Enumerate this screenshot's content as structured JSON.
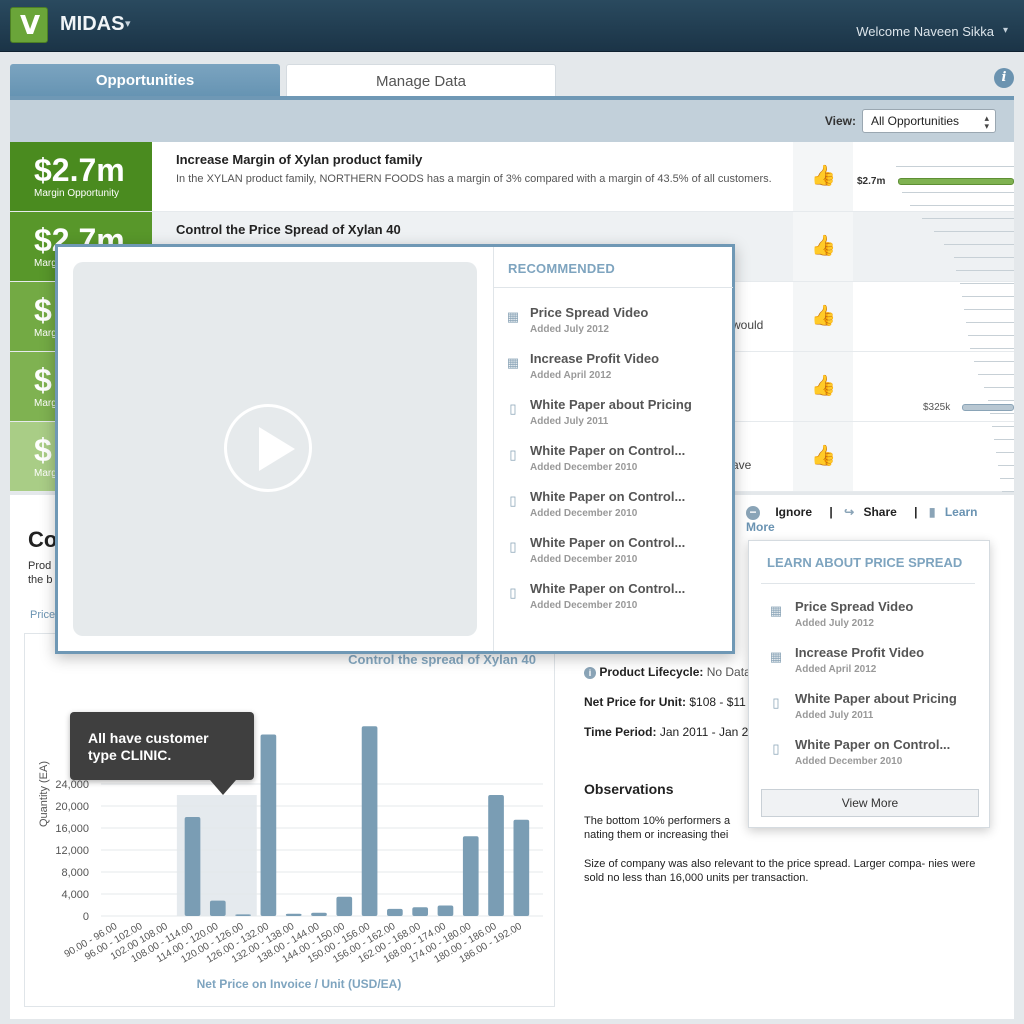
{
  "header": {
    "app_name": "MIDAS",
    "app_caret": "▾",
    "welcome": "Welcome Naveen Sikka",
    "welcome_caret": "▾",
    "logo_icon": "vf-logo",
    "logo_glyph": "V"
  },
  "tabs": [
    {
      "label": "Opportunities",
      "active": true
    },
    {
      "label": "Manage Data",
      "active": false
    }
  ],
  "info_icon": "i",
  "view": {
    "label": "View:",
    "selected": "All Opportunities",
    "caret": "▴▾"
  },
  "opportunities": [
    {
      "amount": "$2.7m",
      "amount_label": "Margin Opportunity",
      "title": "Increase Margin of Xylan product family",
      "description": "In the XYLAN product family, NORTHERN FOODS has a margin of 3% compared with a margin of 43.5% of all customers.",
      "fragment": "",
      "color": "#4a8b1f"
    },
    {
      "amount": "$2.7m",
      "amount_label": "Margin Opportunity",
      "title": "Control the Price Spread of Xylan 40",
      "description": "",
      "fragment": "",
      "color": "#58972a"
    },
    {
      "amount": "$",
      "amount_label": "Margin Opportunity",
      "title": "",
      "description": "",
      "fragment": "would",
      "color": "#73aa44"
    },
    {
      "amount": "$",
      "amount_label": "Margin Opportunity",
      "title": "",
      "description": "",
      "fragment": "",
      "color": "#7fb251"
    },
    {
      "amount": "$",
      "amount_label": "Margin Opportunity",
      "title": "",
      "description": "",
      "fragment": "ave",
      "color": "#a9cd86"
    }
  ],
  "spark": {
    "top_label": "$2.7m",
    "mid_label": "$325k",
    "top_color": "#7fb251",
    "mid_color": "#b8c7d2"
  },
  "lower": {
    "title": "Co",
    "subtitle_line1": "Prod",
    "subtitle_line2": "the b",
    "link": "Price"
  },
  "actions": {
    "ignore": "Ignore",
    "sep1": "|",
    "share": "Share",
    "sep2": "|",
    "learn_more": "Learn More",
    "ignore_glyph": "−",
    "share_glyph": "↪",
    "book_glyph": "▮",
    "ignore_icon": "minus-circle-icon",
    "share_icon": "share-arrow-icon",
    "learn_icon": "book-icon"
  },
  "details": {
    "lifecycle_key": "Product Lifecycle:",
    "lifecycle_val": "No Data",
    "net_price_key": "Net Price for Unit:",
    "net_price_val": "$108 - $11",
    "time_period_key": "Time Period:",
    "time_period_val": "Jan 2011 - Jan 2",
    "obs_title": "Observations",
    "obs_1": "The bottom 10% performers a",
    "obs_1b": "nating them or increasing thei",
    "obs_2": "Size of company was also relevant to the price spread. Larger compa- nies were sold no less than 16,000 units per transaction.",
    "info_glyph": "i"
  },
  "modal": {
    "recommended_title": "RECOMMENDED",
    "items": [
      {
        "name": "Price Spread Video",
        "date": "Added July 2012",
        "icon": "film-icon",
        "glyph": "▦"
      },
      {
        "name": "Increase Profit Video",
        "date": "Added April 2012",
        "icon": "film-icon",
        "glyph": "▦"
      },
      {
        "name": "White Paper about Pricing",
        "date": "Added July 2011",
        "icon": "document-icon",
        "glyph": "▯"
      },
      {
        "name": "White Paper on Control...",
        "date": "Added December 2010",
        "icon": "document-icon",
        "glyph": "▯"
      },
      {
        "name": "White Paper on Control...",
        "date": "Added December 2010",
        "icon": "document-icon",
        "glyph": "▯"
      },
      {
        "name": "White Paper on Control...",
        "date": "Added December 2010",
        "icon": "document-icon",
        "glyph": "▯"
      },
      {
        "name": "White Paper on Control...",
        "date": "Added December 2010",
        "icon": "document-icon",
        "glyph": "▯"
      }
    ]
  },
  "popover": {
    "title": "LEARN ABOUT PRICE SPREAD",
    "items": [
      {
        "name": "Price Spread Video",
        "date": "Added July 2012",
        "icon": "film-icon",
        "glyph": "▦"
      },
      {
        "name": "Increase Profit Video",
        "date": "Added April 2012",
        "icon": "film-icon",
        "glyph": "▦"
      },
      {
        "name": "White Paper about Pricing",
        "date": "Added July 2011",
        "icon": "document-icon",
        "glyph": "▯"
      },
      {
        "name": "White Paper on Control...",
        "date": "Added December 2010",
        "icon": "document-icon",
        "glyph": "▯"
      }
    ],
    "view_more": "View More"
  },
  "tooltip": {
    "text": "All have customer type CLINIC."
  },
  "thumb_glyph": "👍",
  "chart_data": {
    "type": "bar",
    "title": "Control the spread of Xylan 40",
    "xlabel": "Net Price on Invoice / Unit  (USD/EA)",
    "ylabel": "Quantity (EA)",
    "ylim": [
      0,
      36000
    ],
    "yticks": [
      "0",
      "4,000",
      "8,000",
      "12,000",
      "16,000",
      "20,000",
      "24,000"
    ],
    "categories": [
      "90.00 - 96.00",
      "96.00 - 102.00",
      "102.00 108.00",
      "108.00 - 114.00",
      "114.00 - 120.00",
      "120.00 - 126.00",
      "126.00 - 132.00",
      "132.00 - 138.00",
      "138.00 - 144.00",
      "144.00 - 150.00",
      "150.00 - 156.00",
      "156.00 - 162.00",
      "162.00 - 168.00",
      "168.00 - 174.00",
      "174.00 - 180.00",
      "180.00 - 186.00",
      "186.00 - 192.00"
    ],
    "values": [
      0,
      0,
      0,
      18000,
      2800,
      300,
      33000,
      400,
      600,
      3500,
      34500,
      1300,
      1600,
      1900,
      14500,
      22000,
      17500
    ],
    "highlight_range": [
      3,
      5
    ],
    "bar_color": "#7a9db4",
    "highlight_color": "#e5eaee"
  }
}
